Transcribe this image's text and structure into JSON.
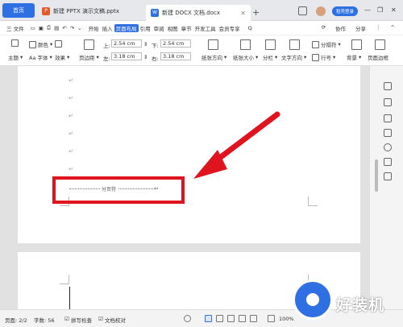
{
  "tabs": {
    "home": "首页",
    "doc1": "新建 PPTX 演示文稿.pptx",
    "doc2": "新建 DOCX 文档.docx",
    "doc1_icon": "P",
    "doc2_icon": "W"
  },
  "header": {
    "login": "稻壳登录"
  },
  "menu": {
    "file": "三 文件",
    "items": [
      "开始",
      "插入",
      "页面布局",
      "引用",
      "审阅",
      "视图",
      "章节",
      "开发工具",
      "会员专享"
    ],
    "active_index": 2,
    "search": "Q",
    "collab": "协作",
    "share": "分享"
  },
  "ribbon": {
    "theme": "主题",
    "colors": "颜色",
    "font": "Aa 字体",
    "effects": "效果",
    "margins": "页边距",
    "top_lbl": "上:",
    "top_val": "2.54 cm",
    "bottom_lbl": "下:",
    "bottom_val": "2.54 cm",
    "left_lbl": "左:",
    "left_val": "3.18 cm",
    "right_lbl": "右:",
    "right_val": "3.18 cm",
    "orientation": "纸张方向",
    "size": "纸张大小",
    "columns": "分栏",
    "text_dir": "文字方向",
    "break": "分隔符",
    "line_num": "行号",
    "background": "背景",
    "page_border": "页面边框"
  },
  "document": {
    "para_mark": "↵",
    "page_break": "分页符"
  },
  "status": {
    "page": "页面: 2/2",
    "words": "字数: 56",
    "spell": "拼写检查",
    "proof": "文档校对",
    "zoom": "100%"
  },
  "watermark": {
    "text": "好装机"
  },
  "colors": {
    "accent": "#2f6fe4",
    "highlight": "#e0141e"
  }
}
